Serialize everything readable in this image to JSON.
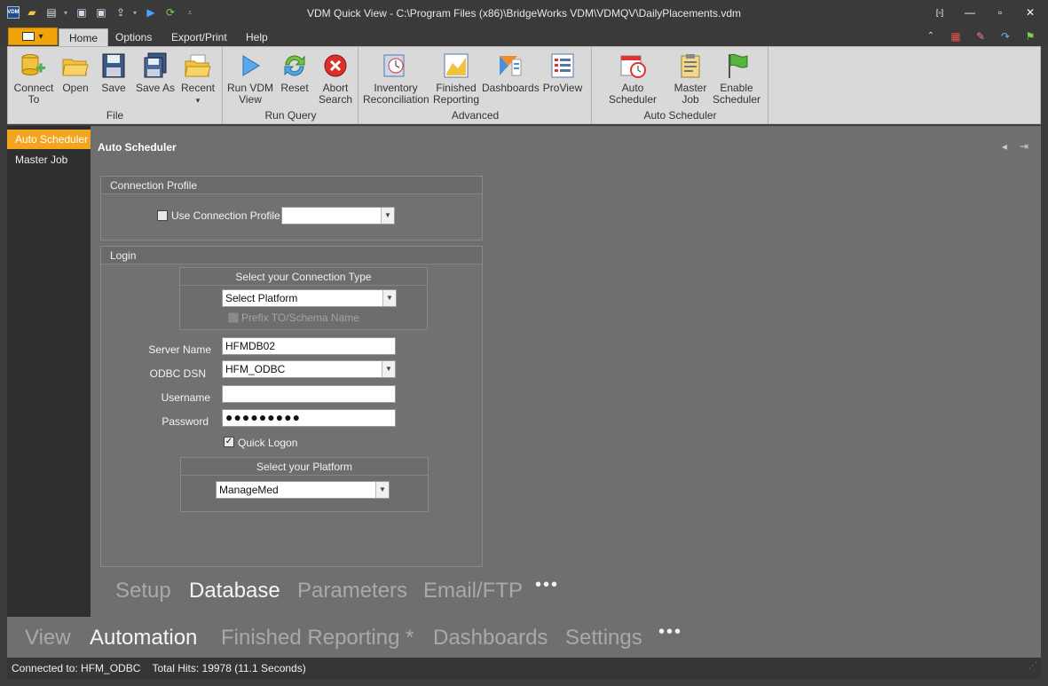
{
  "window": {
    "title": "VDM Quick View - C:\\Program Files (x86)\\BridgeWorks VDM\\VDMQV\\DailyPlacements.vdm",
    "logo_text": "VDM"
  },
  "ribbon_tabs": [
    "Home",
    "Options",
    "Export/Print",
    "Help"
  ],
  "ribbon": {
    "groups": [
      {
        "title": "File",
        "buttons": [
          "Connect\nTo",
          "Open",
          "Save",
          "Save As",
          "Recent"
        ]
      },
      {
        "title": "Run Query",
        "buttons": [
          "Run VDM\nView",
          "Reset",
          "Abort\nSearch"
        ]
      },
      {
        "title": "Advanced",
        "buttons": [
          "Inventory\nReconciliation",
          "Finished\nReporting",
          "Dashboards",
          "ProView"
        ]
      },
      {
        "title": "Auto Scheduler",
        "buttons": [
          "Auto Scheduler",
          "Master\nJob",
          "Enable\nScheduler"
        ]
      }
    ],
    "recent_arrow": "▾"
  },
  "left_nav": {
    "items": [
      "Auto Scheduler",
      "Master Job"
    ],
    "active_index": 0
  },
  "panel": {
    "title": "Auto Scheduler"
  },
  "connection_profile": {
    "header": "Connection Profile",
    "use_label": "Use Connection Profile",
    "use_checked": false,
    "profile_value": ""
  },
  "login": {
    "header": "Login",
    "connection_type": {
      "header": "Select your Connection Type",
      "platform_value": "Select Platform",
      "prefix_label": "Prefix TO/Schema Name",
      "prefix_enabled": false
    },
    "server_name_label": "Server Name",
    "server_name_value": "HFMDB02",
    "odbc_dsn_label": "ODBC DSN",
    "odbc_dsn_value": "HFM_ODBC",
    "username_label": "Username",
    "username_value": "",
    "password_label": "Password",
    "password_value": "●●●●●●●●●",
    "quick_logon_label": "Quick Logon",
    "quick_logon_checked": true,
    "platform_box": {
      "header": "Select your Platform",
      "value": "ManageMed"
    }
  },
  "sub_tabs": [
    "Setup",
    "Database",
    "Parameters",
    "Email/FTP",
    "•••"
  ],
  "sub_tabs_active": 1,
  "bottom_tabs": [
    "View",
    "Automation",
    "Finished Reporting *",
    "Dashboards",
    "Settings",
    "•••"
  ],
  "bottom_tabs_active": 1,
  "status": {
    "text": "Connected to: HFM_ODBC    Total Hits: 19978 (11.1 Seconds)"
  },
  "colors": {
    "accent": "#f4a520",
    "panel_bg": "#6f6f6f",
    "ribbon_bg": "#d9d9d9",
    "chrome_bg": "#3a3a3a"
  }
}
